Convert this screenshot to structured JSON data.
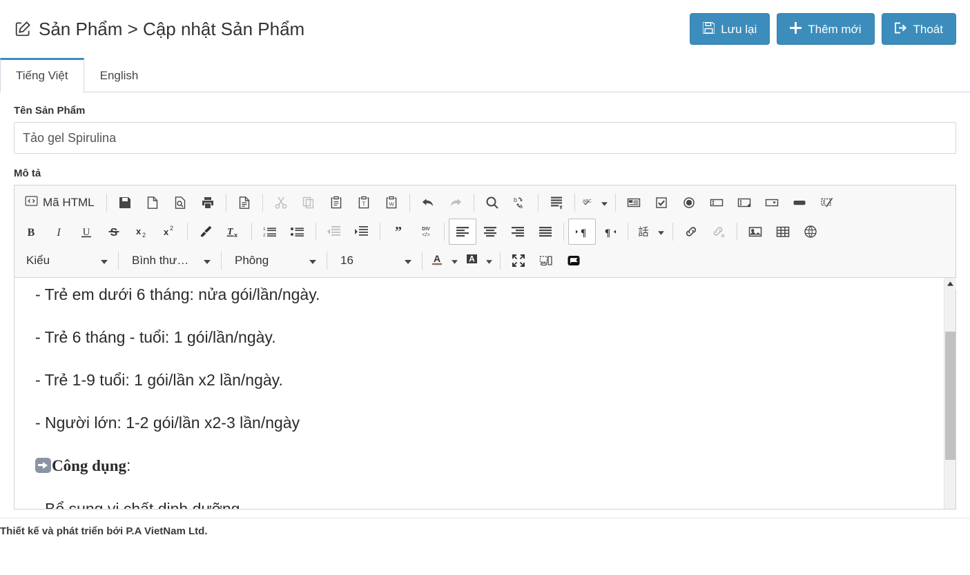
{
  "header": {
    "title": "Sản Phẩm > Cập nhật Sản Phẩm",
    "edit_icon": "edit-square-icon",
    "buttons": [
      {
        "label": "Lưu lại",
        "icon": "floppy-save-icon"
      },
      {
        "label": "Thêm mới",
        "icon": "plus-icon"
      },
      {
        "label": "Thoát",
        "icon": "sign-out-icon"
      }
    ],
    "accent_color": "#3c8dbc"
  },
  "tabs": [
    {
      "label": "Tiếng Việt",
      "active": true
    },
    {
      "label": "English",
      "active": false
    }
  ],
  "form": {
    "product_name": {
      "label": "Tên Sản Phẩm",
      "value": "Tảo gel Spirulina",
      "placeholder": "Tên Sản Phẩm"
    },
    "description": {
      "label": "Mô tả"
    }
  },
  "editor": {
    "source_button": {
      "label": "Mã HTML",
      "icon": "source-code-icon"
    },
    "row1_icons": [
      "save-icon",
      "new-page-icon",
      "preview-icon",
      "print-icon",
      "templates-icon",
      "cut-icon",
      "copy-icon",
      "paste-icon",
      "paste-plain-text-icon",
      "paste-from-word-icon",
      "undo-icon",
      "redo-icon",
      "find-icon",
      "replace-icon",
      "select-all-icon",
      "spell-check-icon",
      "form-icon",
      "checkbox-icon",
      "radio-button-icon",
      "text-field-icon",
      "textarea-icon",
      "select-field-icon",
      "button-icon",
      "image-button-icon"
    ],
    "row2_icons": [
      "bold-icon",
      "italic-icon",
      "underline-icon",
      "strikethrough-icon",
      "subscript-icon",
      "superscript-icon",
      "remove-format-brush-icon",
      "remove-text-format-icon",
      "numbered-list-icon",
      "bulleted-list-icon",
      "outdent-icon",
      "indent-icon",
      "blockquote-icon",
      "div-container-icon",
      "align-left-icon",
      "align-center-icon",
      "align-right-icon",
      "justify-icon",
      "text-direction-ltr-icon",
      "text-direction-rtl-icon",
      "language-icon",
      "link-icon",
      "unlink-icon",
      "image-icon",
      "table-icon",
      "iframe-globe-icon"
    ],
    "row3": {
      "styles": {
        "label": "Kiểu",
        "icon": "chevron-down-icon"
      },
      "format": {
        "label": "Bình thư…",
        "icon": "chevron-down-icon"
      },
      "font": {
        "label": "Phông",
        "icon": "chevron-down-icon"
      },
      "size": {
        "label": "16",
        "icon": "chevron-down-icon"
      },
      "text_color": {
        "icon": "text-color-icon"
      },
      "bg_color": {
        "icon": "background-color-icon"
      },
      "maximize": {
        "icon": "maximize-icon"
      },
      "show_blocks": {
        "icon": "show-blocks-icon"
      },
      "flag": {
        "icon": "flag-icon"
      }
    },
    "content": {
      "lines": [
        "- Trẻ em dưới 6 tháng: nửa gói/lần/ngày.",
        "- Trẻ 6 tháng - tuổi: 1 gói/lần/ngày.",
        "- Trẻ 1-9 tuổi: 1 gói/lần x2 lần/ngày.",
        "- Người lớn: 1-2 gói/lần x2-3 lần/ngày"
      ],
      "heading": "Công dụng",
      "heading_suffix": ":",
      "heading_emoji": "right-arrow-emoji",
      "line_after_heading": "- Bổ sung vi chất dinh dưỡng."
    },
    "scrollbar": {
      "up_arrow": "scroll-up-arrow-icon"
    }
  },
  "footer": {
    "text": "Thiết kế và phát triển bởi P.A VietNam Ltd."
  }
}
